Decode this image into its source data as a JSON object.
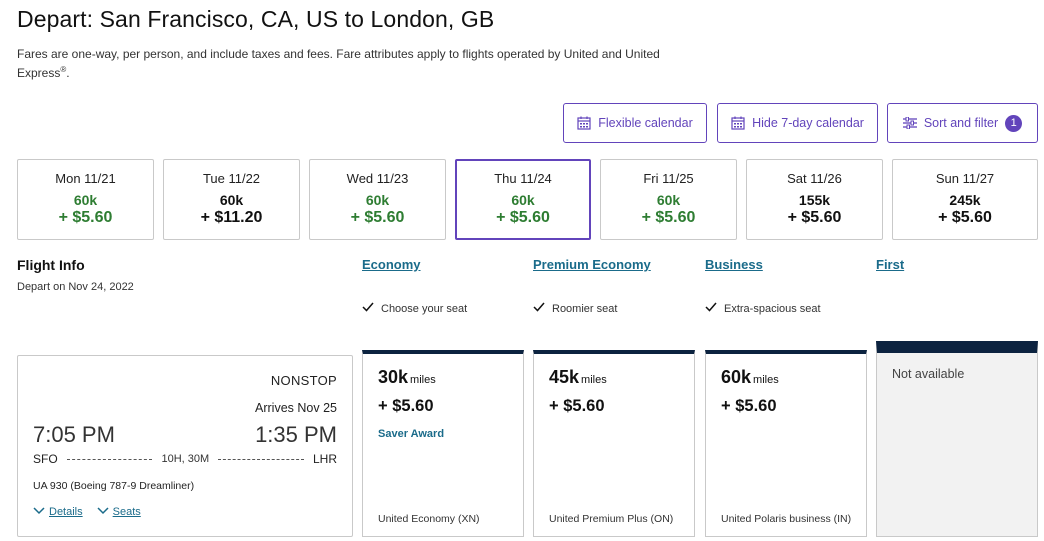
{
  "header": {
    "title": "Depart: San Francisco, CA, US to London, GB",
    "note_main": "Fares are one-way, per person, and include taxes and fees. Fare attributes apply to flights operated by United and United Express",
    "note_reg": "®",
    "note_end": "."
  },
  "toolbar": {
    "flexible": "Flexible calendar",
    "hide7": "Hide 7-day calendar",
    "sort": "Sort and filter",
    "sort_badge": "1"
  },
  "days": [
    {
      "label": "Mon 11/21",
      "miles": "60k",
      "tax": "+ $5.60",
      "color": "green"
    },
    {
      "label": "Tue 11/22",
      "miles": "60k",
      "tax": "+ $11.20",
      "color": "black"
    },
    {
      "label": "Wed 11/23",
      "miles": "60k",
      "tax": "+ $5.60",
      "color": "green"
    },
    {
      "label": "Thu 11/24",
      "miles": "60k",
      "tax": "+ $5.60",
      "color": "green",
      "selected": true
    },
    {
      "label": "Fri 11/25",
      "miles": "60k",
      "tax": "+ $5.60",
      "color": "green"
    },
    {
      "label": "Sat 11/26",
      "miles": "155k",
      "tax": "+ $5.60",
      "color": "black"
    },
    {
      "label": "Sun 11/27",
      "miles": "245k",
      "tax": "+ $5.60",
      "color": "black"
    }
  ],
  "flight_info": {
    "title": "Flight Info",
    "depart_date": "Depart on Nov 24, 2022"
  },
  "cabins": [
    {
      "name": "Economy",
      "feature": "Choose your seat"
    },
    {
      "name": "Premium Economy",
      "feature": "Roomier seat"
    },
    {
      "name": "Business",
      "feature": "Extra-spacious seat"
    },
    {
      "name": "First"
    }
  ],
  "flight": {
    "stops": "NONSTOP",
    "arrives": "Arrives Nov 25",
    "dep_time": "7:05 PM",
    "arr_time": "1:35 PM",
    "origin": "SFO",
    "destination": "LHR",
    "duration": "10H, 30M",
    "aircraft": "UA 930 (Boeing 787-9 Dreamliner)",
    "details_link": "Details",
    "seats_link": "Seats"
  },
  "fares": [
    {
      "miles": "30k",
      "unit": "miles",
      "tax": "+ $5.60",
      "saver": "Saver Award",
      "name": "United Economy (XN)"
    },
    {
      "miles": "45k",
      "unit": "miles",
      "tax": "+ $5.60",
      "name": "United Premium Plus (ON)"
    },
    {
      "miles": "60k",
      "unit": "miles",
      "tax": "+ $5.60",
      "name": "United Polaris business (IN)"
    },
    {
      "unavailable": "Not available"
    }
  ],
  "colors": {
    "accent": "#6244bb",
    "link": "#1a6b8a",
    "navy": "#0c2340",
    "green": "#2e7d32"
  }
}
